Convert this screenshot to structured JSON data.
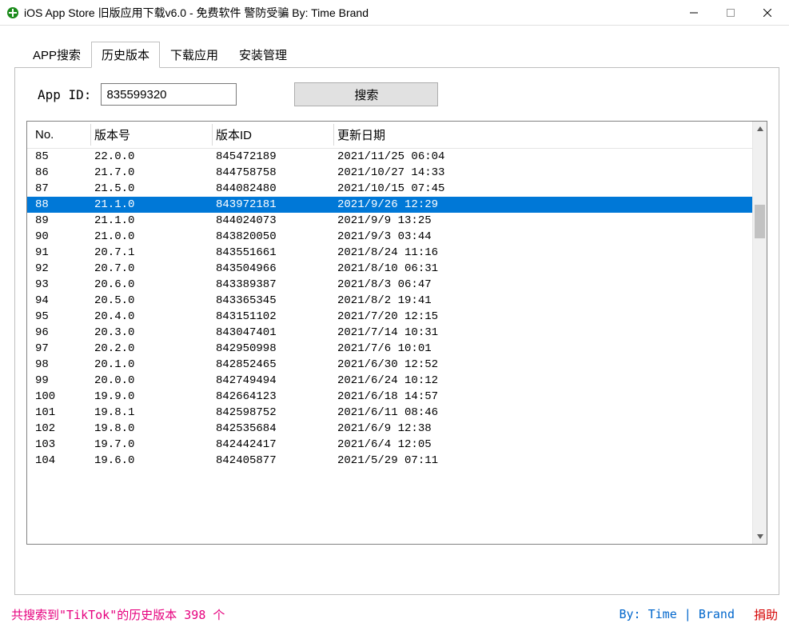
{
  "window": {
    "title": "iOS App Store 旧版应用下载v6.0 - 免费软件 警防受骗 By: Time Brand"
  },
  "tabs": [
    {
      "label": "APP搜索",
      "active": false
    },
    {
      "label": "历史版本",
      "active": true
    },
    {
      "label": "下载应用",
      "active": false
    },
    {
      "label": "安装管理",
      "active": false
    }
  ],
  "search": {
    "label": "App ID:",
    "value": "835599320",
    "button_label": "搜索"
  },
  "table": {
    "headers": {
      "no": "No.",
      "version": "版本号",
      "version_id": "版本ID",
      "date": "更新日期"
    },
    "selected_index": 3,
    "rows": [
      {
        "no": "85",
        "version": "22.0.0",
        "version_id": "845472189",
        "date": "2021/11/25 06:04"
      },
      {
        "no": "86",
        "version": "21.7.0",
        "version_id": "844758758",
        "date": "2021/10/27 14:33"
      },
      {
        "no": "87",
        "version": "21.5.0",
        "version_id": "844082480",
        "date": "2021/10/15 07:45"
      },
      {
        "no": "88",
        "version": "21.1.0",
        "version_id": "843972181",
        "date": "2021/9/26 12:29"
      },
      {
        "no": "89",
        "version": "21.1.0",
        "version_id": "844024073",
        "date": "2021/9/9 13:25"
      },
      {
        "no": "90",
        "version": "21.0.0",
        "version_id": "843820050",
        "date": "2021/9/3 03:44"
      },
      {
        "no": "91",
        "version": "20.7.1",
        "version_id": "843551661",
        "date": "2021/8/24 11:16"
      },
      {
        "no": "92",
        "version": "20.7.0",
        "version_id": "843504966",
        "date": "2021/8/10 06:31"
      },
      {
        "no": "93",
        "version": "20.6.0",
        "version_id": "843389387",
        "date": "2021/8/3 06:47"
      },
      {
        "no": "94",
        "version": "20.5.0",
        "version_id": "843365345",
        "date": "2021/8/2 19:41"
      },
      {
        "no": "95",
        "version": "20.4.0",
        "version_id": "843151102",
        "date": "2021/7/20 12:15"
      },
      {
        "no": "96",
        "version": "20.3.0",
        "version_id": "843047401",
        "date": "2021/7/14 10:31"
      },
      {
        "no": "97",
        "version": "20.2.0",
        "version_id": "842950998",
        "date": "2021/7/6 10:01"
      },
      {
        "no": "98",
        "version": "20.1.0",
        "version_id": "842852465",
        "date": "2021/6/30 12:52"
      },
      {
        "no": "99",
        "version": "20.0.0",
        "version_id": "842749494",
        "date": "2021/6/24 10:12"
      },
      {
        "no": "100",
        "version": "19.9.0",
        "version_id": "842664123",
        "date": "2021/6/18 14:57"
      },
      {
        "no": "101",
        "version": "19.8.1",
        "version_id": "842598752",
        "date": "2021/6/11 08:46"
      },
      {
        "no": "102",
        "version": "19.8.0",
        "version_id": "842535684",
        "date": "2021/6/9 12:38"
      },
      {
        "no": "103",
        "version": "19.7.0",
        "version_id": "842442417",
        "date": "2021/6/4 12:05"
      },
      {
        "no": "104",
        "version": "19.6.0",
        "version_id": "842405877",
        "date": "2021/5/29 07:11"
      }
    ]
  },
  "footer": {
    "status": "共搜索到\"TikTok\"的历史版本 398 个",
    "brand": "By: Time | Brand",
    "donate": "捐助"
  }
}
